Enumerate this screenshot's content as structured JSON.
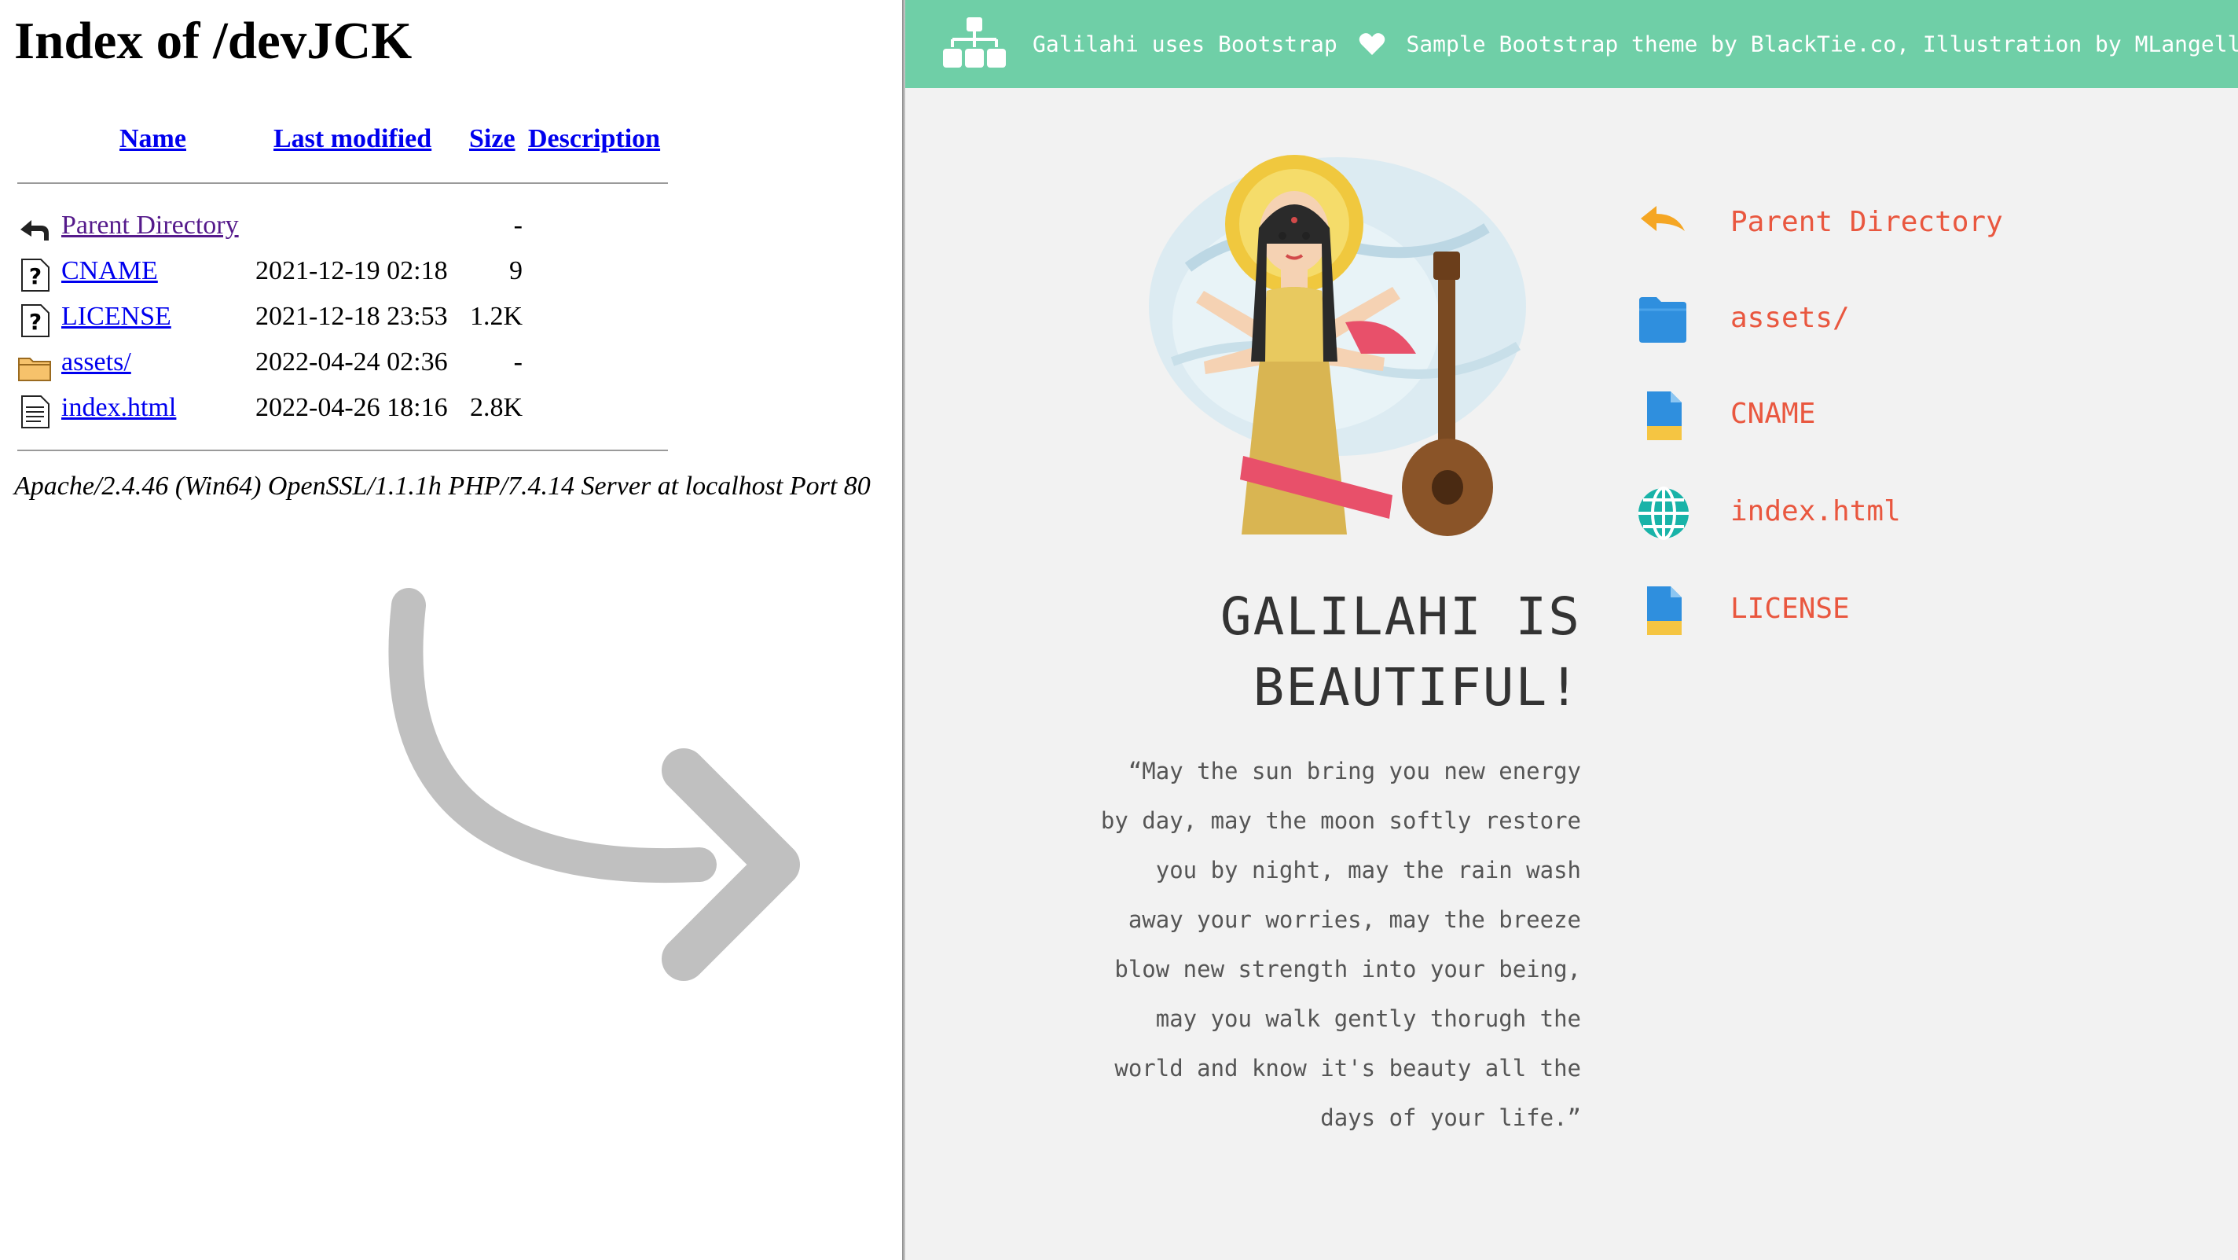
{
  "left_panel": {
    "title": "Index of /devJCK",
    "columns": {
      "name": "Name",
      "last_modified": "Last modified",
      "size": "Size",
      "description": "Description"
    },
    "rows": [
      {
        "name": "Parent Directory",
        "date": "",
        "size": "-",
        "icon": "back-icon"
      },
      {
        "name": "CNAME",
        "date": "2021-12-19 02:18",
        "size": "9",
        "icon": "unknown-file-icon"
      },
      {
        "name": "LICENSE",
        "date": "2021-12-18 23:53",
        "size": "1.2K",
        "icon": "unknown-file-icon"
      },
      {
        "name": "assets/",
        "date": "2022-04-24 02:36",
        "size": "-",
        "icon": "folder-icon"
      },
      {
        "name": "index.html",
        "date": "2022-04-26 18:16",
        "size": "2.8K",
        "icon": "text-file-icon"
      }
    ],
    "server_signature": "Apache/2.4.46 (Win64) OpenSSL/1.1.1h PHP/7.4.14 Server at localhost Port 80"
  },
  "right_panel": {
    "header": {
      "credit_left": "Galilahi uses Bootstrap",
      "credit_right": "Sample Bootstrap theme by BlackTie.co, Illustration by MLangella"
    },
    "tagline": "GALILAHI IS BEAUTIFUL!",
    "quote": "“May the sun bring you new energy by day, may the moon softly restore you by night, may the rain wash away your worries, may the breeze blow new strength into your being, may you walk gently thorugh the world and know it's beauty all the days of your life.”",
    "items": [
      {
        "label": "Parent Directory",
        "icon": "back-arrow-icon"
      },
      {
        "label": "assets/",
        "icon": "folder-icon"
      },
      {
        "label": "CNAME",
        "icon": "file-icon"
      },
      {
        "label": "index.html",
        "icon": "globe-icon"
      },
      {
        "label": "LICENSE",
        "icon": "file-icon"
      }
    ],
    "colors": {
      "header_bg": "#6fcfa7",
      "link": "#e9573f",
      "page_bg": "#f2f2f2"
    }
  }
}
